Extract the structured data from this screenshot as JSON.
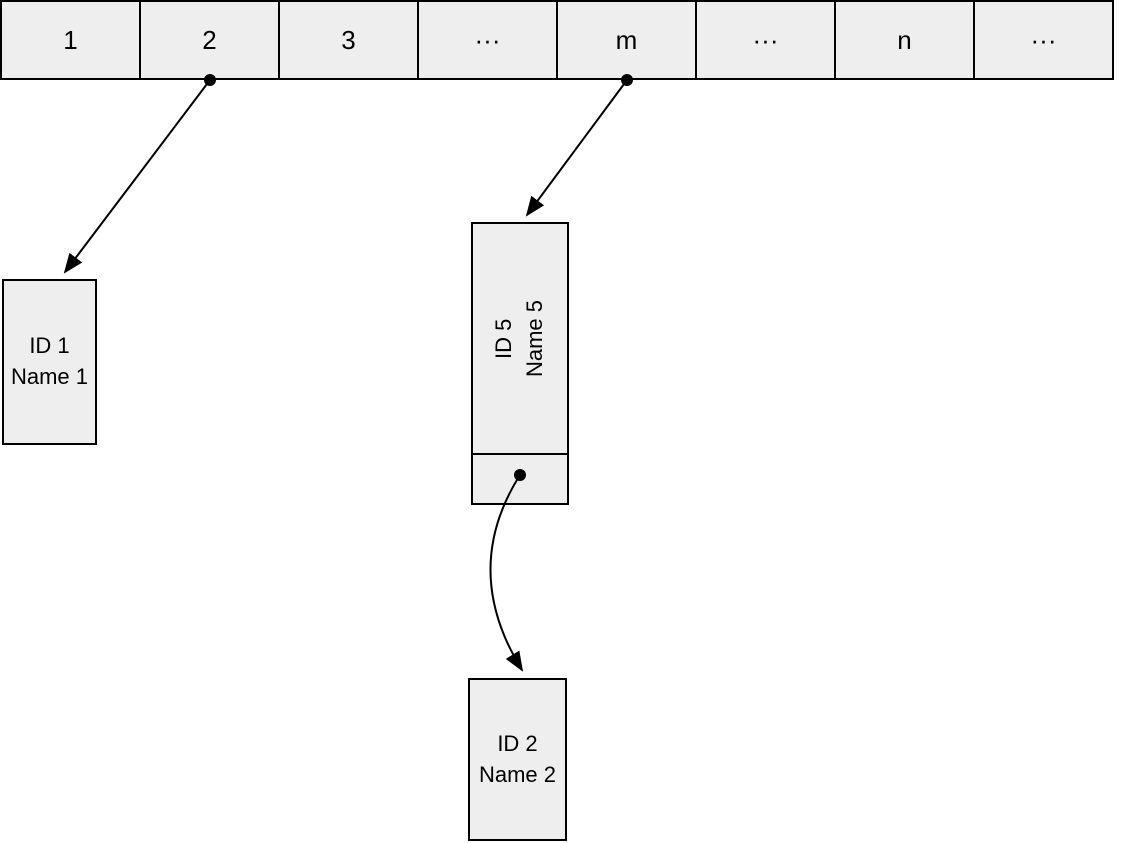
{
  "array": {
    "cells": [
      "1",
      "2",
      "3",
      "···",
      "m",
      "···",
      "n",
      "···"
    ]
  },
  "nodes": {
    "node1": {
      "line1": "ID 1",
      "line2": "Name 1"
    },
    "node5": {
      "line1": "ID 5",
      "line2": "Name 5"
    },
    "node2": {
      "line1": "ID 2",
      "line2": "Name 2"
    }
  }
}
